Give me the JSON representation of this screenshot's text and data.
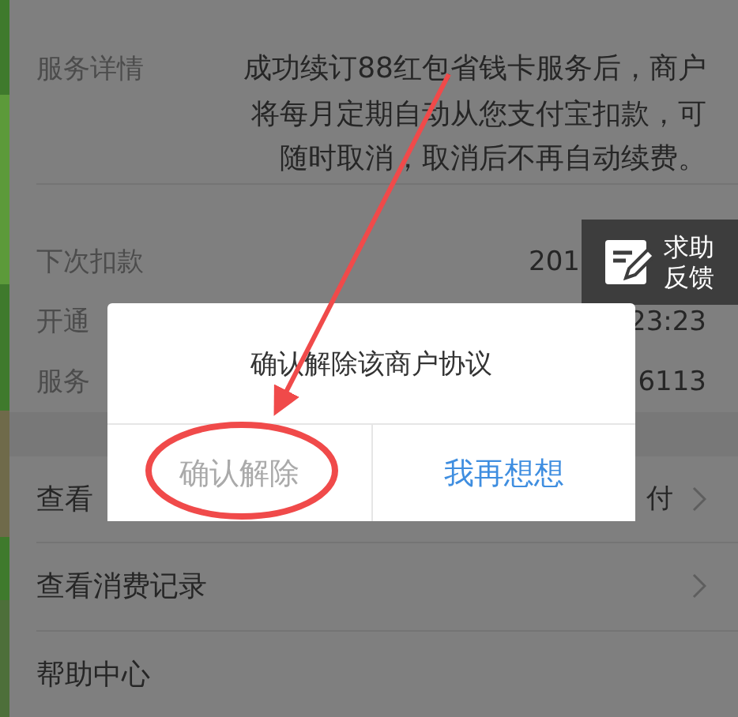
{
  "details": {
    "label": "服务详情",
    "text": "成功续订88红包省钱卡服务后，商户将每月定期自动从您支付宝扣款，可随时取消，取消后不再自动续费。"
  },
  "info_rows": [
    {
      "label": "下次扣款",
      "value": "201"
    },
    {
      "label": "开通",
      "value": "23:23"
    },
    {
      "label": "服务",
      "value": "6113"
    }
  ],
  "menu": [
    {
      "label": "查看",
      "value": "付",
      "chevron": true
    },
    {
      "label": "查看消费记录",
      "chevron": true
    },
    {
      "label": "帮助中心",
      "chevron": false
    }
  ],
  "help_button": {
    "lines": [
      "求助",
      "反馈"
    ]
  },
  "dialog": {
    "title": "确认解除该商户协议",
    "buttons": [
      {
        "label": "确认解除",
        "kind": "muted"
      },
      {
        "label": "我再想想",
        "kind": "primary"
      }
    ]
  }
}
